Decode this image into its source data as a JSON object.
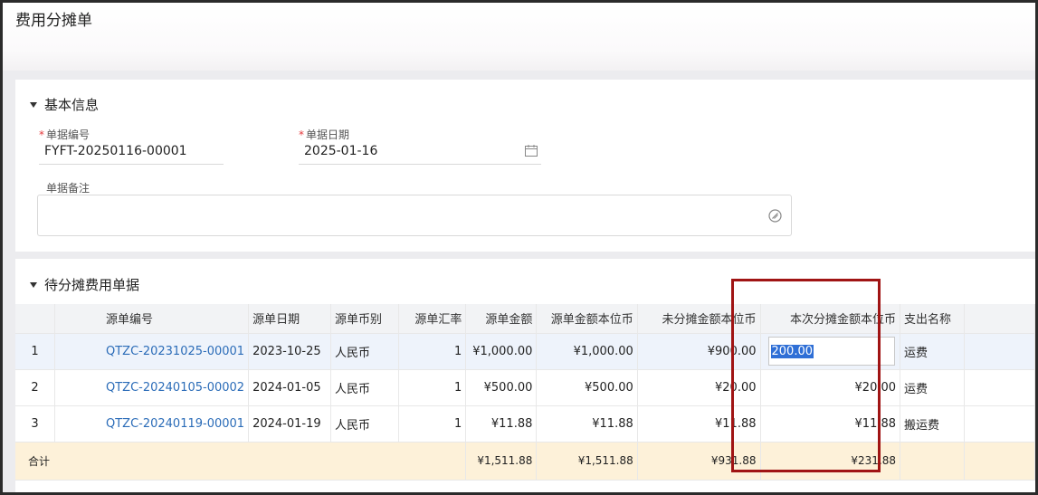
{
  "page": {
    "title": "费用分摊单"
  },
  "basic": {
    "section_title": "基本信息",
    "doc_no_label": "单据编号",
    "doc_no_value": "FYFT-20250116-00001",
    "doc_date_label": "单据日期",
    "doc_date_value": "2025-01-16",
    "remark_label": "单据备注",
    "remark_value": "",
    "required_mark": "*"
  },
  "pending": {
    "section_title": "待分摊费用单据",
    "headers": {
      "src_no": "源单编号",
      "src_date": "源单日期",
      "src_currency": "源单币别",
      "src_rate": "源单汇率",
      "src_amount": "源单金额",
      "src_amount_local": "源单金额本位币",
      "unallocated_local": "未分摊金额本位币",
      "current_alloc_local": "本次分摊金额本位币",
      "expense_name": "支出名称"
    },
    "rows": [
      {
        "idx": "1",
        "src_no": "QTZC-20231025-00001",
        "src_date": "2023-10-25",
        "src_currency": "人民币",
        "src_rate": "1",
        "src_amount": "¥1,000.00",
        "src_amount_local": "¥1,000.00",
        "unallocated_local": "¥900.00",
        "current_alloc_local": "200.00",
        "expense_name": "运费"
      },
      {
        "idx": "2",
        "src_no": "QTZC-20240105-00002",
        "src_date": "2024-01-05",
        "src_currency": "人民币",
        "src_rate": "1",
        "src_amount": "¥500.00",
        "src_amount_local": "¥500.00",
        "unallocated_local": "¥20.00",
        "current_alloc_local": "¥20.00",
        "expense_name": "运费"
      },
      {
        "idx": "3",
        "src_no": "QTZC-20240119-00001",
        "src_date": "2024-01-19",
        "src_currency": "人民币",
        "src_rate": "1",
        "src_amount": "¥11.88",
        "src_amount_local": "¥11.88",
        "unallocated_local": "¥11.88",
        "current_alloc_local": "¥11.88",
        "expense_name": "搬运费"
      }
    ],
    "total": {
      "label": "合计",
      "src_amount": "¥1,511.88",
      "src_amount_local": "¥1,511.88",
      "unallocated_local": "¥931.88",
      "current_alloc_local": "¥231.88"
    }
  },
  "colors": {
    "highlight_border": "#a01414",
    "link": "#2b6cb8",
    "selection": "#2f6fd6",
    "total_row_bg": "#fdf1d9"
  }
}
